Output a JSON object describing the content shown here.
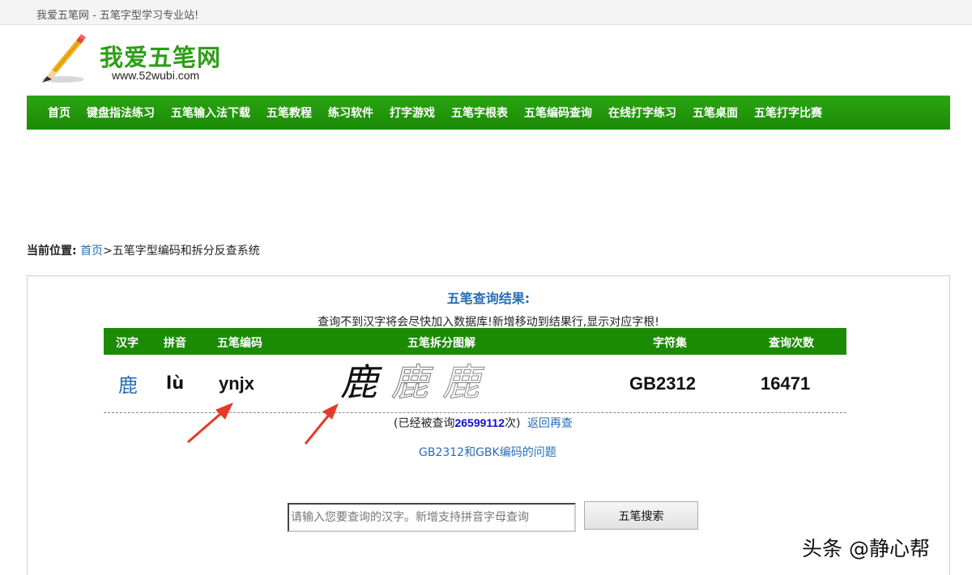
{
  "topbar": {
    "text": "我爱五笔网 - 五笔字型学习专业站!"
  },
  "logo": {
    "title": "我爱五笔网",
    "url": "www.52wubi.com",
    "title_color": "#2e9e17"
  },
  "nav": {
    "items": [
      "首页",
      "键盘指法练习",
      "五笔输入法下载",
      "五笔教程",
      "练习软件",
      "打字游戏",
      "五笔字根表",
      "五笔编码查询",
      "在线打字练习",
      "五笔桌面",
      "五笔打字比赛"
    ],
    "color": "#1c8a06"
  },
  "breadcrumb": {
    "label": "当前位置:",
    "home": "首页",
    "rest": ">五笔字型编码和拆分反查系统"
  },
  "result": {
    "title": "五笔查询结果:",
    "notice": "查询不到汉字将会尽快加入数据库!新增移动到结果行,显示对应字根!",
    "headers": {
      "char": "汉字",
      "pinyin": "拼音",
      "code": "五笔编码",
      "decomp": "五笔拆分图解",
      "charset": "字符集",
      "count": "查询次数"
    },
    "row": {
      "char": "鹿",
      "pinyin": "lù",
      "code": "ynjx",
      "decomp_glyphs": [
        "鹿",
        "鹿",
        "鹿"
      ],
      "charset": "GB2312",
      "count": "16471"
    },
    "stats": {
      "prefix": "(已经被查询",
      "number": "26599112",
      "suffix": "次)",
      "back_link": "返回再查"
    },
    "gb_link": "GB2312和GBK编码的问题"
  },
  "search": {
    "placeholder": "请输入您要查询的汉字。新增支持拼音字母查询",
    "button": "五笔搜索"
  },
  "annotation_arrows": {
    "color": "#e53a2a",
    "icon": "arrow-icon"
  },
  "watermark": "头条 @静心帮"
}
